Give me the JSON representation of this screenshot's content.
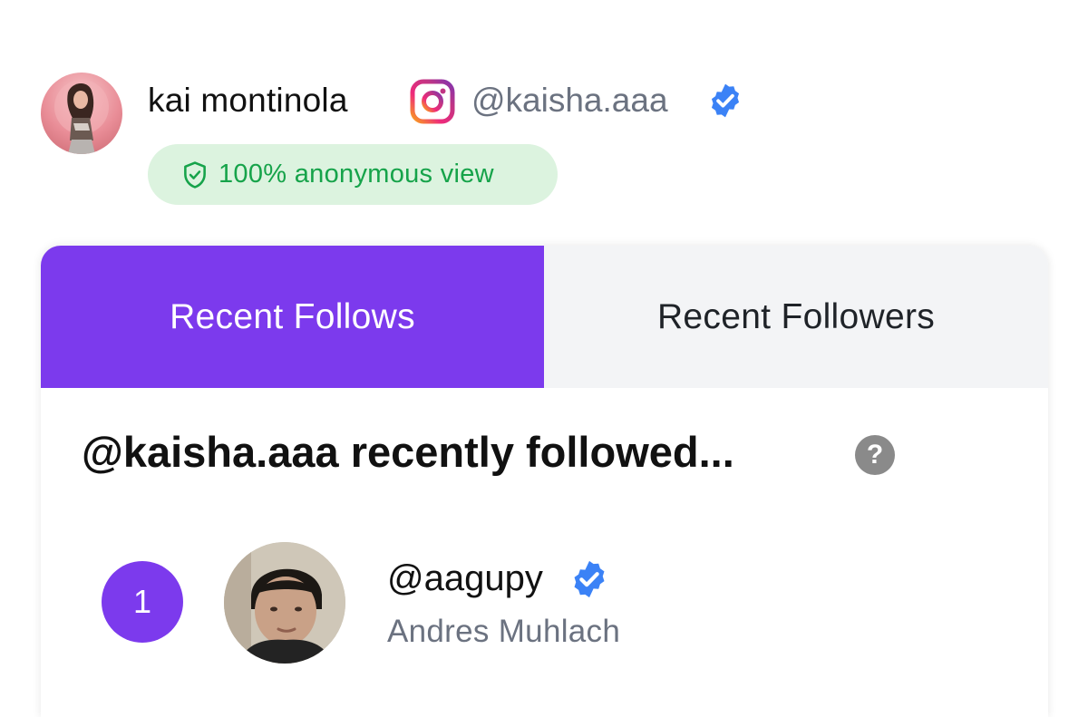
{
  "profile": {
    "name": "kai montinola",
    "platform_icon": "instagram-icon",
    "handle": "@kaisha.aaa",
    "verified": true,
    "anonymous_badge": "100% anonymous view"
  },
  "tabs": [
    {
      "label": "Recent Follows",
      "active": true
    },
    {
      "label": "Recent Followers",
      "active": false
    }
  ],
  "section": {
    "title": "@kaisha.aaa recently followed...",
    "help_icon": "?"
  },
  "follows": [
    {
      "rank": "1",
      "handle": "@aagupy",
      "verified": true,
      "full_name": "Andres Muhlach"
    }
  ],
  "colors": {
    "accent": "#7c3aed",
    "badge_bg": "#dcf3df",
    "badge_text": "#16a34a",
    "verified": "#3b82f6",
    "muted_text": "#6b7280",
    "inactive_tab_bg": "#f3f4f6"
  }
}
